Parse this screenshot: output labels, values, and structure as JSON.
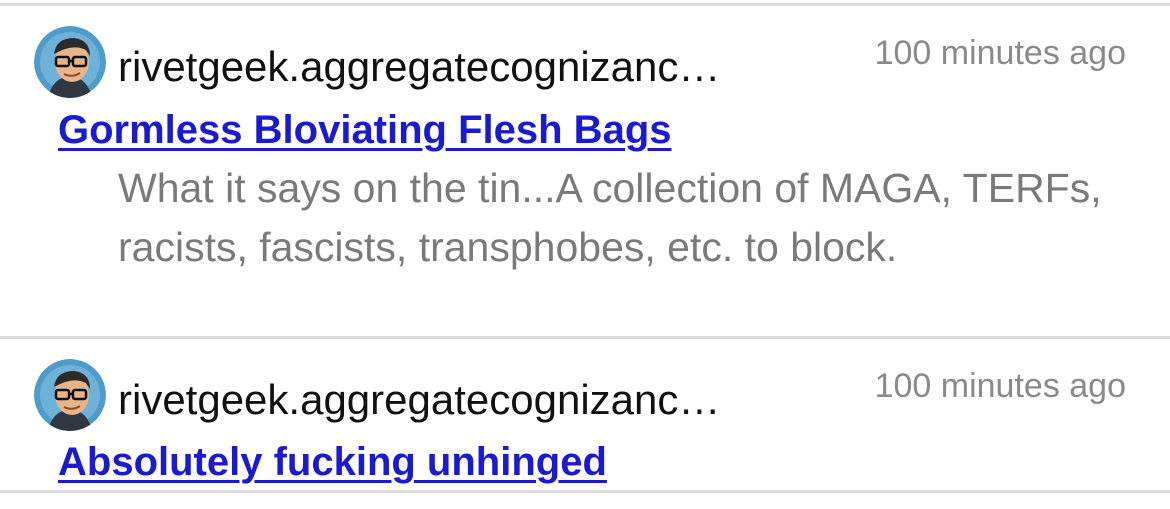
{
  "posts": [
    {
      "author": "rivetgeek.aggregatecognizanc…",
      "time": "100 minutes ago",
      "title": "Gormless Bloviating Flesh Bags",
      "description": "What it says on the tin...A collection of MAGA, TERFs, racists, fascists, transphobes, etc. to block."
    },
    {
      "author": "rivetgeek.aggregatecognizanc…",
      "time": "100 minutes ago",
      "title": "Absolutely fucking unhinged"
    }
  ],
  "colors": {
    "link": "#1a1ad6",
    "author": "#111111",
    "time": "#8a8a8a",
    "description": "#7a7a7a",
    "divider": "#dcdcdc"
  },
  "icons": {
    "avatar": "cartoon-man-with-glasses-avatar-icon"
  }
}
